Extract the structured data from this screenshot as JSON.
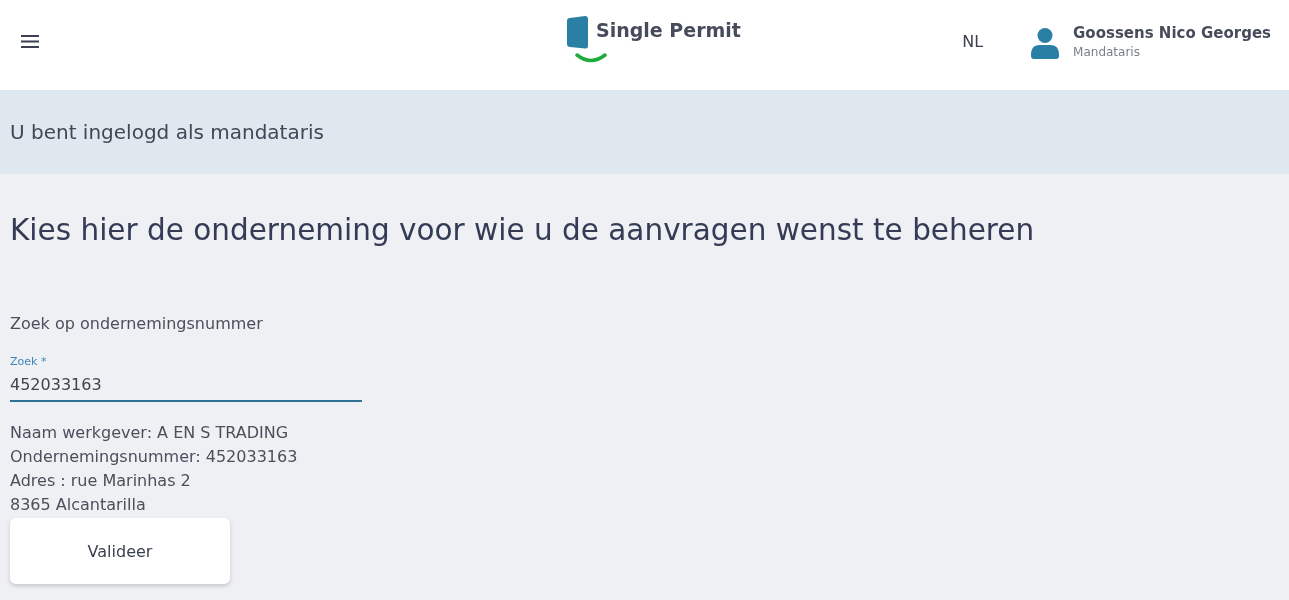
{
  "header": {
    "logo": {
      "text": "Single Permit"
    },
    "language": "NL",
    "user": {
      "name": "Goossens Nico Georges",
      "role": "Mandataris"
    }
  },
  "banner": {
    "text": "U bent ingelogd als mandataris"
  },
  "page": {
    "heading": "Kies hier de onderneming voor wie u de aanvragen wenst te beheren",
    "search_label": "Zoek op ondernemingsnummer",
    "field": {
      "label": "Zoek *",
      "value": "452033163"
    },
    "details": [
      "Naam werkgever: A EN S TRADING",
      "Ondernemingsnummer: 452033163",
      "Adres : rue Marinhas 2",
      "8365 Alcantarilla"
    ],
    "buttons": [
      "Valideer"
    ]
  }
}
